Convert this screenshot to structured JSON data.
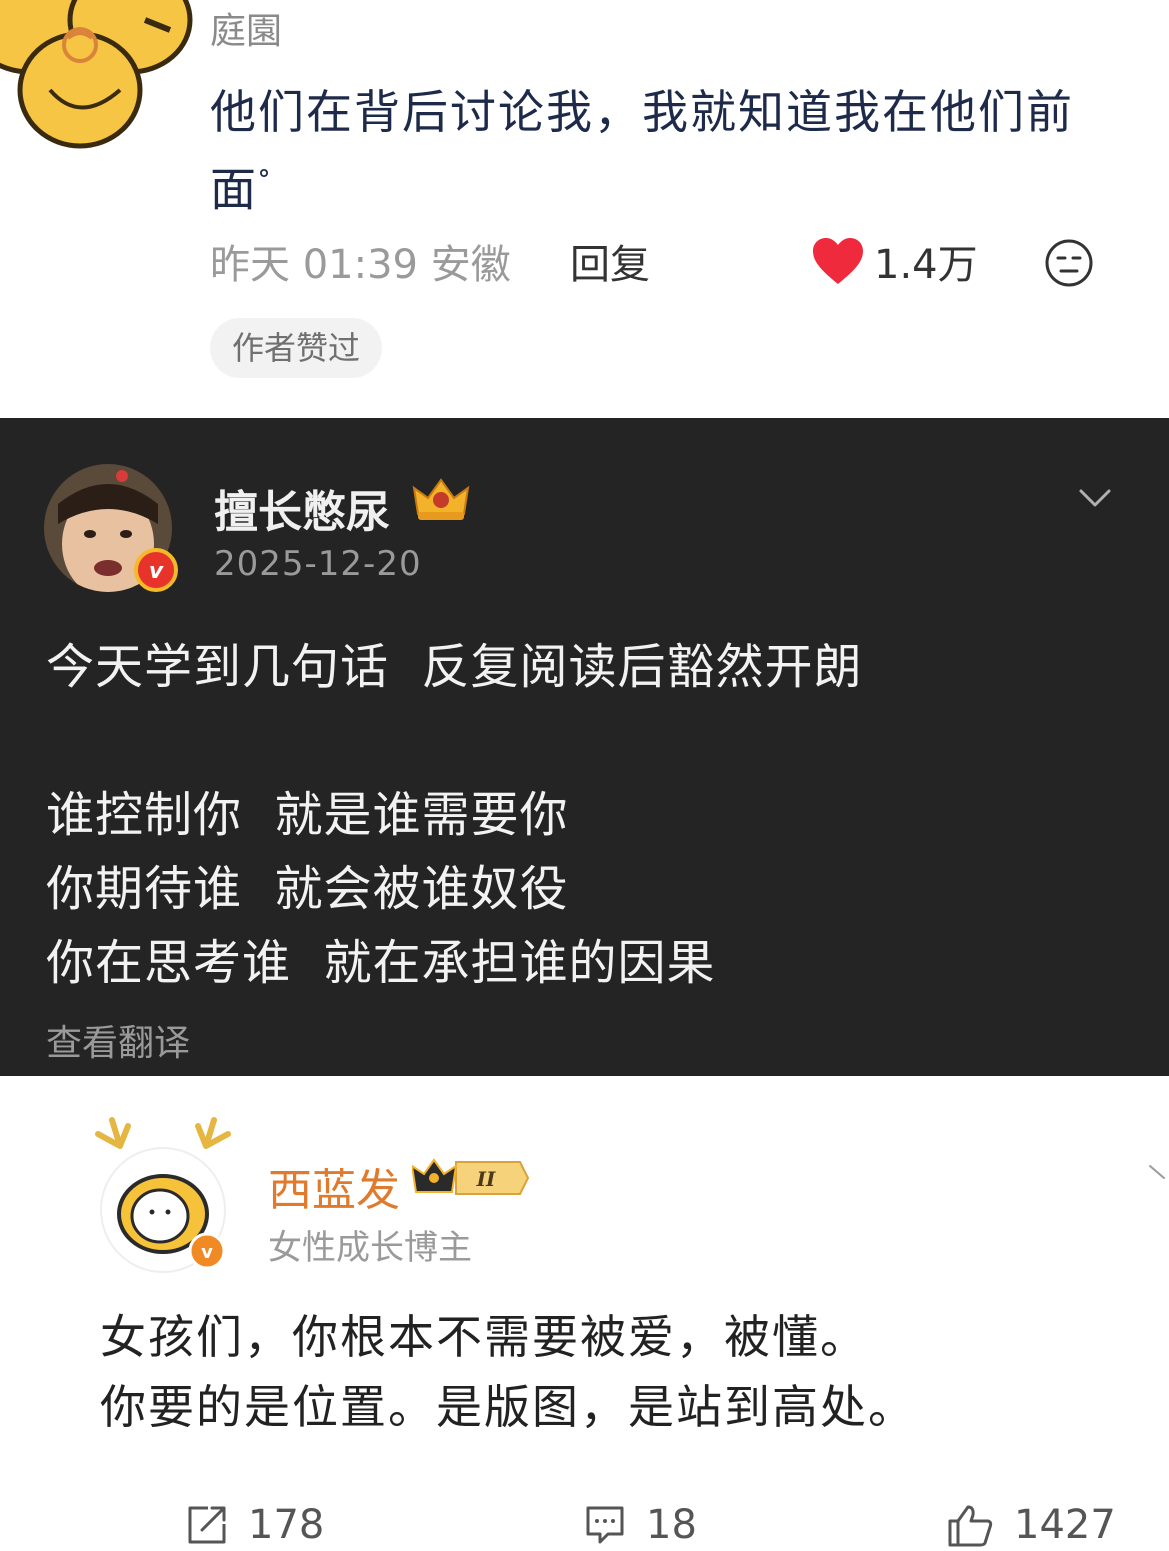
{
  "comment": {
    "author": "庭園",
    "text": "他们在背后讨论我，我就知道我在他们前面",
    "time": "昨天 01:39",
    "location": "安徽",
    "reply_label": "回复",
    "likes": "1.4万",
    "tag": "作者赞过",
    "colors": {
      "heart": "#ee2a3c",
      "text": "#1e2a4a"
    }
  },
  "post1": {
    "username": "擅长憋尿",
    "date": "2025-12-20",
    "text": "今天学到几句话  反复阅读后豁然开朗\n\n谁控制你  就是谁需要你\n你期待谁  就会被谁奴役\n你在思考谁  就在承担谁的因果",
    "translate_label": "查看翻译",
    "background": "#242424"
  },
  "post2": {
    "username": "西蓝发",
    "level_badge": "II",
    "subtitle": "女性成长博主",
    "text": "女孩们，你根本不需要被爱，被懂。\n你要的是位置。是版图，是站到高处。",
    "actions": {
      "share": "178",
      "comment": "18",
      "like": "1427"
    },
    "colors": {
      "username": "#e07a2c"
    }
  },
  "icons": [
    "flower-avatar-icon",
    "heart-icon",
    "emoji-icon",
    "crown-icon",
    "chevron-down-icon",
    "verified-badge-icon",
    "share-icon",
    "comment-icon",
    "thumbs-up-icon"
  ]
}
